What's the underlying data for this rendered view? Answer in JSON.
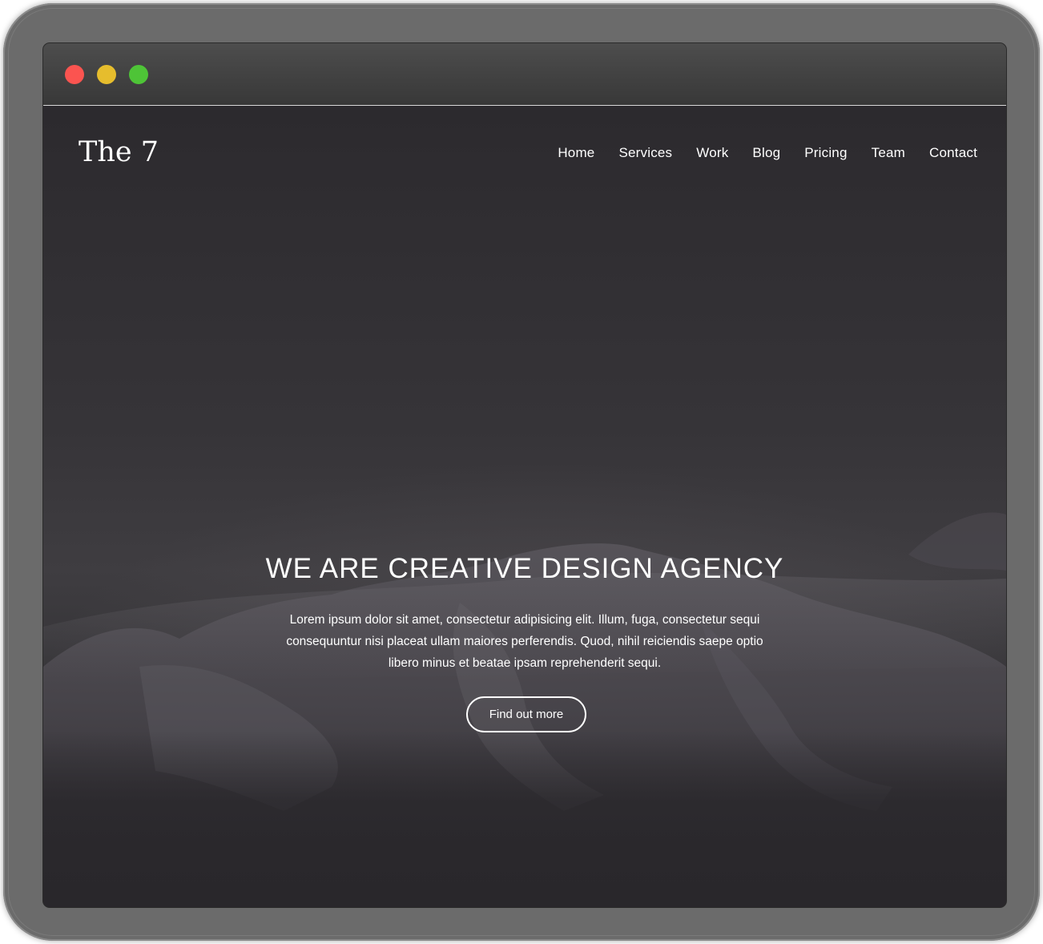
{
  "window": {
    "controls": [
      "close",
      "minimize",
      "zoom"
    ]
  },
  "header": {
    "brand": "The 7",
    "nav": [
      "Home",
      "Services",
      "Work",
      "Blog",
      "Pricing",
      "Team",
      "Contact"
    ]
  },
  "hero": {
    "title": "WE ARE CREATIVE DESIGN AGENCY",
    "body": "Lorem ipsum dolor sit amet, consectetur adipisicing elit. Illum, fuga, consectetur sequi consequuntur nisi placeat ullam maiores perferendis. Quod, nihil reiciendis saepe optio libero minus et beatae ipsam reprehenderit sequi.",
    "cta": "Find out more"
  },
  "colors": {
    "close": "#fb5450",
    "minimize": "#e6bd2d",
    "zoom": "#4ec437"
  }
}
